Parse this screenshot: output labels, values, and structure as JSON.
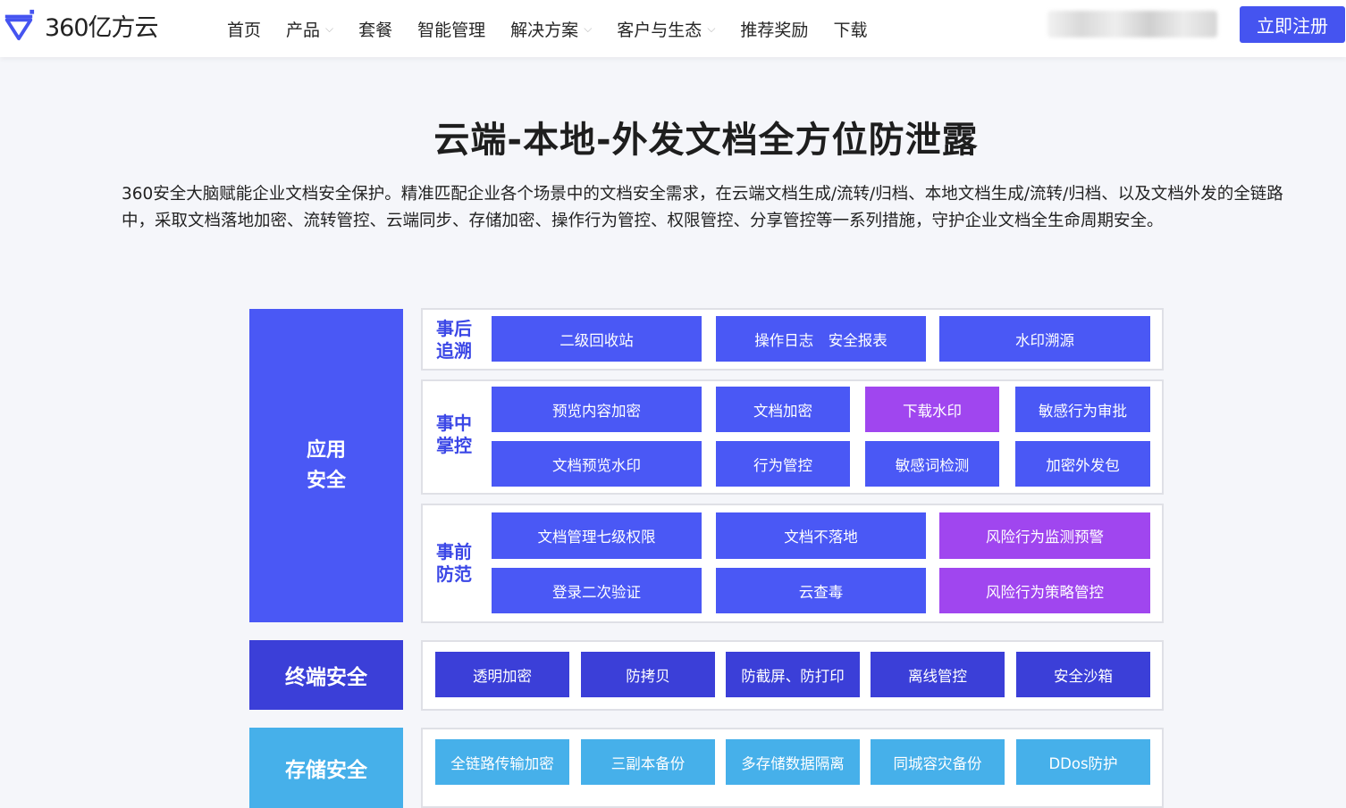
{
  "brand": {
    "name": "360亿方云",
    "color": "#4554f0"
  },
  "nav": {
    "items": [
      {
        "label": "首页",
        "dropdown": false
      },
      {
        "label": "产品",
        "dropdown": true
      },
      {
        "label": "套餐",
        "dropdown": false
      },
      {
        "label": "智能管理",
        "dropdown": false
      },
      {
        "label": "解决方案",
        "dropdown": true
      },
      {
        "label": "客户与生态",
        "dropdown": true
      },
      {
        "label": "推荐奖励",
        "dropdown": false
      },
      {
        "label": "下载",
        "dropdown": false
      }
    ],
    "register_label": "立即注册"
  },
  "main": {
    "title": "云端-本地-外发文档全方位防泄露",
    "description": "360安全大脑赋能企业文档安全保护。精准匹配企业各个场景中的文档安全需求，在云端文档生成/流转/归档、本地文档生成/流转/归档、以及文档外发的全链路中，采取文档落地加密、流转管控、云端同步、存储加密、操作行为管控、权限管控、分享管控等一系列措施，守护企业文档全生命周期安全。"
  },
  "diagram": {
    "categories": {
      "app": {
        "line1": "应用",
        "line2": "安全"
      },
      "terminal": "终端安全",
      "storage": "存储安全"
    },
    "after": {
      "label1": "事后",
      "label2": "追溯",
      "items": [
        "二级回收站",
        "操作日志　安全报表",
        "水印溯源"
      ]
    },
    "during": {
      "label1": "事中",
      "label2": "掌控",
      "items": [
        "预览内容加密",
        "文档加密",
        "下载水印",
        "敏感行为审批",
        "文档预览水印",
        "行为管控",
        "敏感词检测",
        "加密外发包"
      ]
    },
    "before": {
      "label1": "事前",
      "label2": "防范",
      "items": [
        "文档管理七级权限",
        "文档不落地",
        "风险行为监测预警",
        "登录二次验证",
        "云查毒",
        "风险行为策略管控"
      ]
    },
    "terminal_items": [
      "透明加密",
      "防拷贝",
      "防截屏、防打印",
      "离线管控",
      "安全沙箱"
    ],
    "storage_items": [
      "全链路传输加密",
      "三副本备份",
      "多存储数据隔离",
      "同城容灾备份",
      "DDos防护"
    ],
    "colors": {
      "blue": "#4a58f5",
      "purple": "#a046ef",
      "dark": "#3b3fd8",
      "cyan": "#46b0ea"
    }
  }
}
